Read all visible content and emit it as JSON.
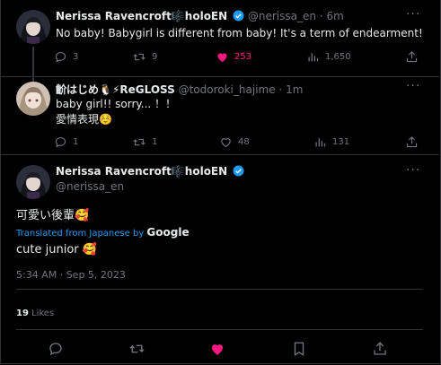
{
  "tweets": [
    {
      "name": "Nerissa Ravencroft🎼️holoEN",
      "handle": "@nerissa_en",
      "time": "6m",
      "text": "No baby! Babygirl is different from baby! It's a term of endearment!",
      "replies": "3",
      "retweets": "9",
      "likes": "253",
      "views": "1,650"
    },
    {
      "name": "齘はじめ🐧⚡ReGLOSS",
      "handle": "@todoroki_hajime",
      "time": "1m",
      "text_line1": "baby girl!! sorry... ！！",
      "text_line2": "愛情表現☺️",
      "replies": "1",
      "retweets": "1",
      "likes": "48",
      "views": "131"
    }
  ],
  "focused": {
    "name": "Nerissa Ravencroft🎼️holoEN",
    "handle": "@nerissa_en",
    "original_text": "可愛い後輩🥰",
    "translated_from": "Translated from Japanese by",
    "translator": "Google",
    "translation": "cute junior 🥰",
    "timestamp": "5:34 AM · Sep 5, 2023",
    "likes_count": "19",
    "likes_label": "Likes"
  },
  "separator": "·",
  "more_label": "···",
  "colors": {
    "accent": "#1d9bf0",
    "like": "#f91880",
    "muted": "#71767b",
    "background": "#000000"
  },
  "icons": [
    "reply-icon",
    "retweet-icon",
    "like-icon",
    "views-icon",
    "share-icon",
    "bookmark-icon",
    "verified-icon"
  ]
}
